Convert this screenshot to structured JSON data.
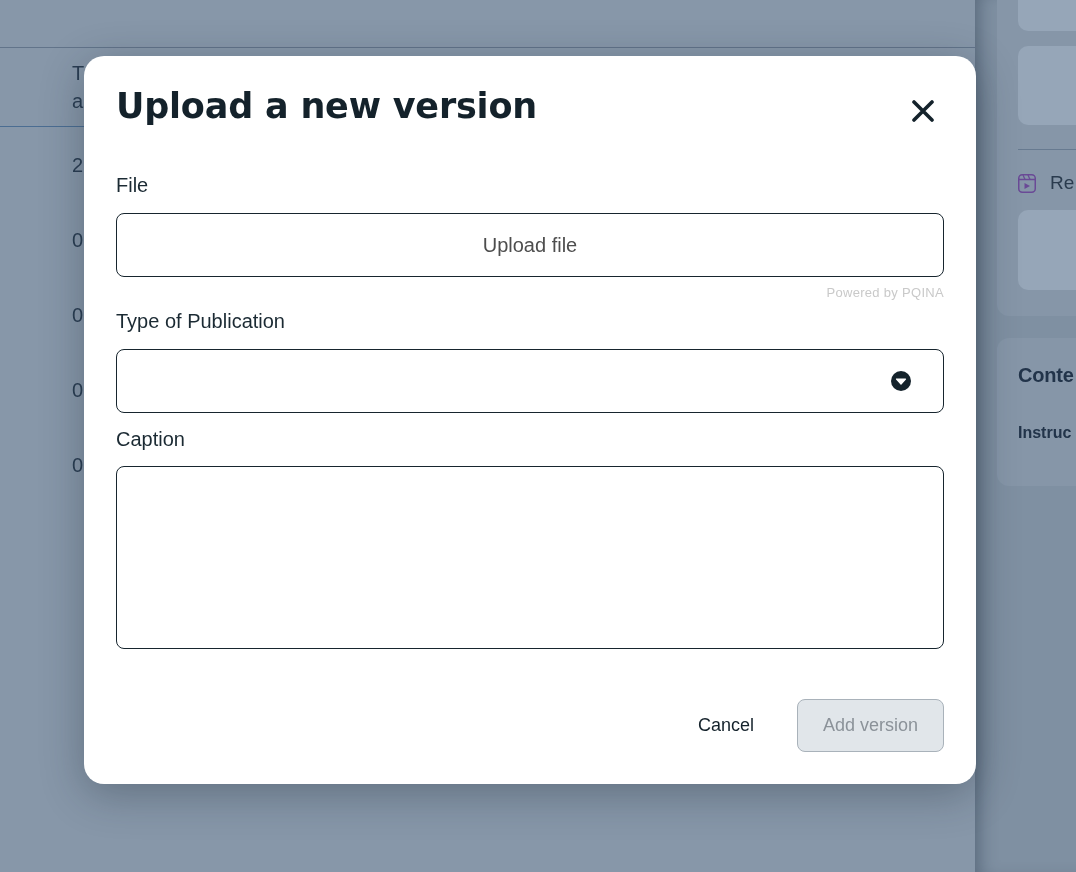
{
  "background": {
    "table": {
      "header_lines": [
        "T",
        "a"
      ],
      "rows": [
        "2",
        "0",
        "0",
        "0",
        "0"
      ]
    }
  },
  "side_panel": {
    "section": {
      "label": "Re"
    },
    "card": {
      "title": "Conte",
      "label": "Instruc"
    }
  },
  "modal": {
    "title": "Upload a new version",
    "fields": [
      {
        "kind": "file",
        "label": "File",
        "action": "Upload file",
        "credit": "Powered by PQINA"
      },
      {
        "kind": "select",
        "label": "Type of Publication"
      },
      {
        "kind": "textarea",
        "label": "Caption"
      }
    ],
    "buttons": [
      {
        "kind": "text",
        "label": "Cancel",
        "disabled": false
      },
      {
        "kind": "primary",
        "label": "Add version",
        "disabled": true
      }
    ]
  }
}
